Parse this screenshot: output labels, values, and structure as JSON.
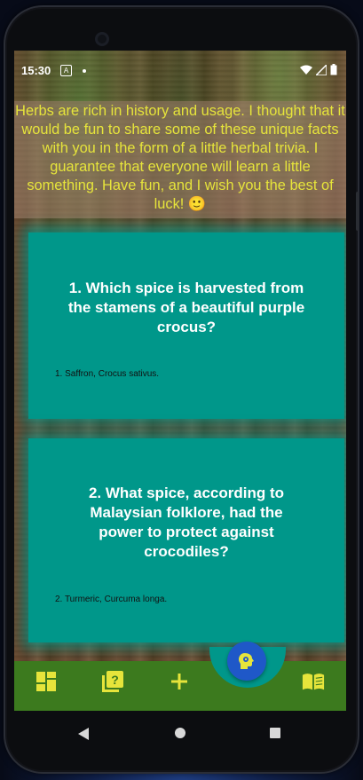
{
  "status_bar": {
    "time": "15:30",
    "notif_a": "A"
  },
  "intro": {
    "text": "Herbs are rich in history and usage. I thought that it would be fun to share some of these unique facts with you in the form of a little herbal trivia. I guarantee that everyone will learn a little something.  Have fun, and I wish you the best of luck! 🙂"
  },
  "cards": [
    {
      "question": "1. Which spice is harvested from the stamens of a beautiful purple crocus?",
      "answer": "1. Saffron, Crocus sativus."
    },
    {
      "question": "2. What spice, according to Malaysian folklore, had the power to protect against crocodiles?",
      "answer": "2. Turmeric, Curcuma longa."
    }
  ],
  "bottom_nav": {
    "items": [
      {
        "icon": "dashboard-icon"
      },
      {
        "icon": "quiz-icon"
      },
      {
        "icon": "add-icon"
      },
      {
        "icon": "psychology-icon"
      },
      {
        "icon": "book-icon"
      }
    ]
  },
  "colors": {
    "card": "#00978a",
    "intro_text": "#e6e43b",
    "nav_bg": "#3c7a1e",
    "nav_icon": "#e6e43b",
    "fab": "#1f58c8"
  }
}
